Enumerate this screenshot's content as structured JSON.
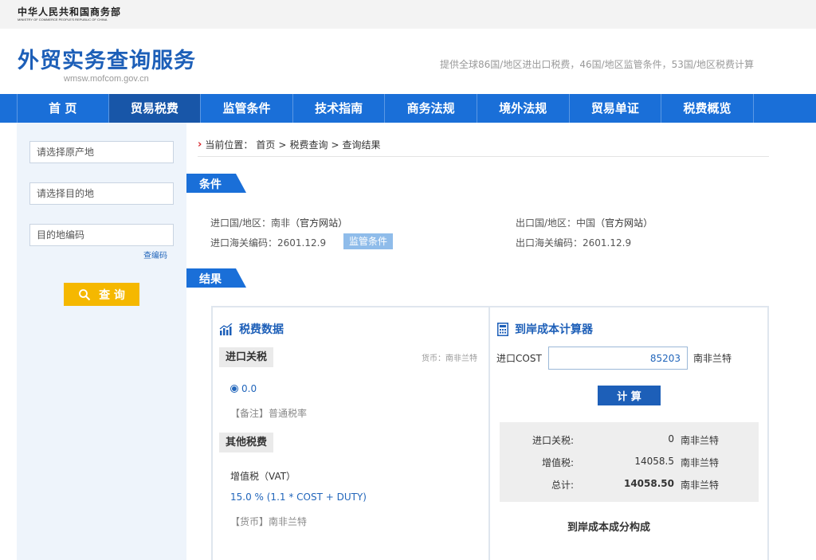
{
  "header": {
    "ministry_cn": "中华人民共和国商务部",
    "ministry_en": "MINISTRY OF COMMERCE PEOPLE'S REPUBLIC OF CHINA",
    "site_title": "外贸实务查询服务",
    "site_domain": "wmsw.mofcom.gov.cn",
    "slogan": "提供全球86国/地区进出口税费，46国/地区监管条件，53国/地区税费计算"
  },
  "nav": {
    "items": [
      {
        "label": "首 页"
      },
      {
        "label": "贸易税费"
      },
      {
        "label": "监管条件"
      },
      {
        "label": "技术指南"
      },
      {
        "label": "商务法规"
      },
      {
        "label": "境外法规"
      },
      {
        "label": "贸易单证"
      },
      {
        "label": "税费概览"
      }
    ],
    "active": "贸易税费"
  },
  "sidebar": {
    "origin_placeholder": "请选择原产地",
    "destination_placeholder": "请选择目的地",
    "code_placeholder": "目的地编码",
    "lookup_code": "查编码",
    "query_button": "查 询"
  },
  "breadcrumb": {
    "prefix": "当前位置：",
    "home": "首页",
    "sep1": ">",
    "tax_query": "税费查询",
    "sep2": ">",
    "result": "查询结果"
  },
  "conditions": {
    "section_title": "条件",
    "import_country_label": "进口国/地区：",
    "import_country": "南非",
    "import_site": "（官方网站）",
    "import_code_label": "进口海关编码：",
    "import_code": "2601.12.9",
    "monitor_button": "监管条件",
    "export_country_label": "出口国/地区：",
    "export_country": "中国",
    "export_site": "（官方网站）",
    "export_code_label": "出口海关编码：",
    "export_code": "2601.12.9"
  },
  "results": {
    "section_title": "结果",
    "tax_data_title": "税费数据",
    "import_duty_label": "进口关税",
    "currency_note": "货币：南非兰特",
    "duty_rate": "0.0",
    "duty_note": "【备注】普通税率",
    "other_taxes_label": "其他税费",
    "vat_label": "增值税（VAT）",
    "vat_formula": "15.0 % (1.1 * COST + DUTY)",
    "vat_currency": "【货币】南非兰特"
  },
  "calculator": {
    "title": "到岸成本计算器",
    "cost_label": "进口COST",
    "cost_value": "85203",
    "cost_unit": "南非兰特",
    "calc_button": "计 算",
    "rows": [
      {
        "label": "进口关税:",
        "value": "0",
        "unit": "南非兰特",
        "bold": false
      },
      {
        "label": "增值税:",
        "value": "14058.5",
        "unit": "南非兰特",
        "bold": false
      },
      {
        "label": "总计:",
        "value": "14058.50",
        "unit": "南非兰特",
        "bold": true
      }
    ],
    "composition_title": "到岸成本成分构成"
  },
  "colors": {
    "nav_blue": "#1a6fd8",
    "nav_active": "#1856a8",
    "brand_blue": "#1d5fb8",
    "query_yellow": "#f5b800",
    "breadcrumb_arrow": "#d8282e"
  }
}
